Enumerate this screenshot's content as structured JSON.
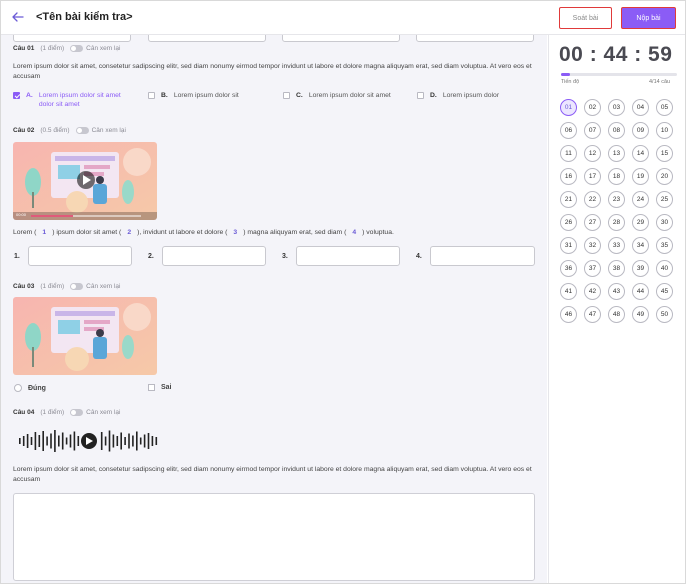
{
  "header": {
    "title": "<Tên bài kiểm tra>",
    "review_label": "Soát bài",
    "submit_label": "Nộp bài"
  },
  "questions": [
    {
      "label": "Câu 01",
      "points": "(1 điểm)",
      "review": "Cân xem lại",
      "text": "Lorem ipsum dolor sit amet, consetetur sadipscing elitr, sed diam nonumy eirmod tempor invidunt ut labore et dolore magna aliquyam erat, sed diam voluptua. At vero eos et accusam",
      "options": [
        {
          "letter": "A.",
          "text": "Lorem ipsum dolor sit amet dolor sit amet",
          "selected": true
        },
        {
          "letter": "B.",
          "text": "Lorem ipsum dolor sit",
          "selected": false
        },
        {
          "letter": "C.",
          "text": "Lorem ipsum dolor sit amet",
          "selected": false
        },
        {
          "letter": "D.",
          "text": "Lorem ipsum dolor",
          "selected": false
        }
      ]
    },
    {
      "label": "Câu 02",
      "points": "(0.5 điểm)",
      "review": "Cân xem lại",
      "video_time": "00:00",
      "fill": {
        "parts": [
          "Lorem (",
          "1",
          ") ipsum dolor sit amet (",
          "2",
          "), invidunt ut labore et dolore (",
          "3",
          ") magna aliquyam erat, sed diam (",
          "4",
          ") voluptua."
        ],
        "blanks": [
          "1.",
          "2.",
          "3.",
          "4."
        ]
      }
    },
    {
      "label": "Câu 03",
      "points": "(1 điểm)",
      "review": "Cân xem lại",
      "true_label": "Đúng",
      "false_label": "Sai"
    },
    {
      "label": "Câu 04",
      "points": "(1 điểm)",
      "review": "Cân xem lại",
      "text": "Lorem ipsum dolor sit amet, consetetur sadipscing elitr, sed diam nonumy eirmod tempor invidunt ut labore et dolore magna aliquyam erat, sed diam voluptua. At vero eos et accusam"
    }
  ],
  "sidebar": {
    "timer": "00 : 44 : 59",
    "progress_label": "Tiến độ",
    "progress_count": "4/14 câu",
    "progress_fraction": 0.08,
    "current": "01",
    "numbers": [
      "01",
      "02",
      "03",
      "04",
      "05",
      "06",
      "07",
      "08",
      "09",
      "10",
      "11",
      "12",
      "13",
      "14",
      "15",
      "16",
      "17",
      "18",
      "19",
      "20",
      "21",
      "22",
      "23",
      "24",
      "25",
      "26",
      "27",
      "28",
      "29",
      "30",
      "31",
      "32",
      "33",
      "34",
      "35",
      "36",
      "37",
      "38",
      "39",
      "40",
      "41",
      "42",
      "43",
      "44",
      "45",
      "46",
      "47",
      "48",
      "49",
      "50"
    ]
  },
  "colors": {
    "accent": "#8b5cf6",
    "highlight_border": "#e03a3a"
  }
}
